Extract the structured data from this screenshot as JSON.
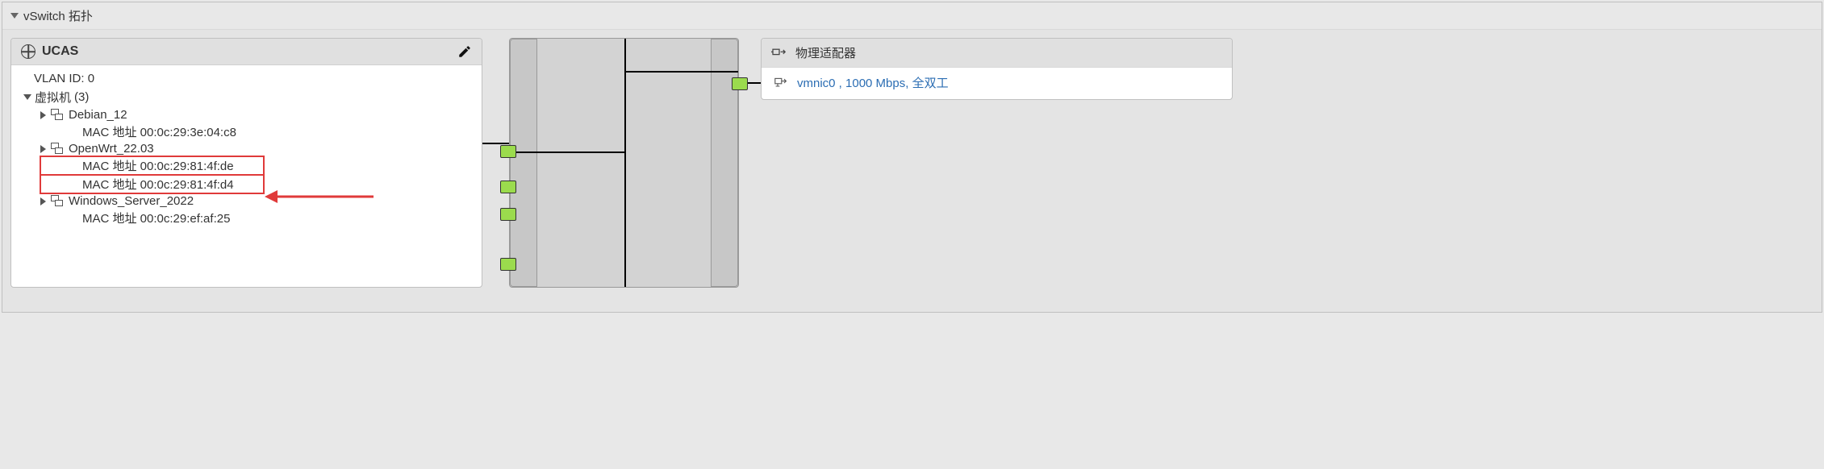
{
  "section": {
    "title": "vSwitch 拓扑"
  },
  "left_card": {
    "title": "UCAS",
    "vlan_label": "VLAN ID:",
    "vlan_value": "0",
    "vm_group_label": "虚拟机",
    "vm_count": "(3)",
    "vms": [
      {
        "name": "Debian_12",
        "macs": [
          "MAC 地址 00:0c:29:3e:04:c8"
        ]
      },
      {
        "name": "OpenWrt_22.03",
        "macs": [
          "MAC 地址 00:0c:29:81:4f:de",
          "MAC 地址 00:0c:29:81:4f:d4"
        ]
      },
      {
        "name": "Windows_Server_2022",
        "macs": [
          "MAC 地址 00:0c:29:ef:af:25"
        ]
      }
    ]
  },
  "right_card": {
    "title": "物理适配器",
    "nic_link": "vmnic0 , 1000 Mbps, 全双工"
  },
  "annotations": {
    "arrow_target": "OpenWrt first MAC"
  }
}
